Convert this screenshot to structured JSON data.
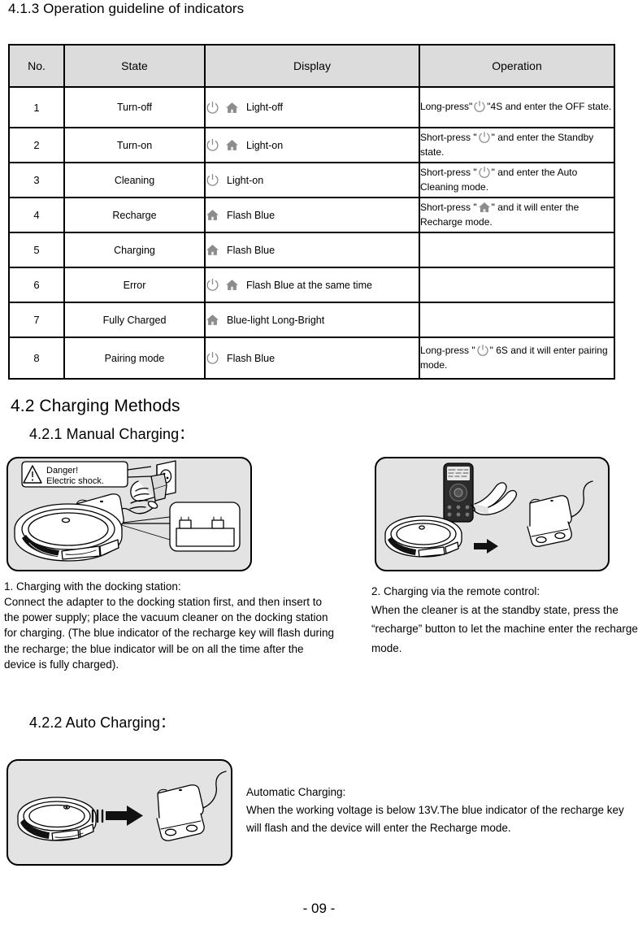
{
  "headings": {
    "s413": "4.1.3 Operation guideline of indicators",
    "s42": "4.2 Charging Methods",
    "s421": "4.2.1 Manual Charging：",
    "s422": "4.2.2 Auto Charging："
  },
  "table": {
    "columns": [
      "No.",
      "State",
      "Display",
      "Operation"
    ],
    "rows": [
      {
        "no": "1",
        "state": "Turn-off",
        "display_icons": [
          "power-icon",
          "home-icon"
        ],
        "display": "Light-off",
        "operation_pre": "Long-press\"",
        "operation_icon": "power-icon",
        "operation_post": "\"4S and enter the OFF state."
      },
      {
        "no": "2",
        "state": "Turn-on",
        "display_icons": [
          "power-icon",
          "home-icon"
        ],
        "display": "Light-on",
        "operation_pre": "Short-press \"",
        "operation_icon": "power-icon",
        "operation_post": "\" and enter the Standby state."
      },
      {
        "no": "3",
        "state": "Cleaning",
        "display_icons": [
          "power-icon"
        ],
        "display": "Light-on",
        "operation_pre": "Short-press \"",
        "operation_icon": "power-icon",
        "operation_post": "\" and enter the Auto Cleaning mode."
      },
      {
        "no": "4",
        "state": "Recharge",
        "display_icons": [
          "home-icon"
        ],
        "display": "Flash Blue",
        "operation_pre": "Short-press \"",
        "operation_icon": "home-icon",
        "operation_post": "\" and it will enter the Recharge mode."
      },
      {
        "no": "5",
        "state": "Charging",
        "display_icons": [
          "home-icon"
        ],
        "display": "Flash Blue",
        "operation_pre": "",
        "operation_icon": "",
        "operation_post": ""
      },
      {
        "no": "6",
        "state": "Error",
        "display_icons": [
          "power-icon",
          "home-icon"
        ],
        "display": "Flash Blue at the same time",
        "operation_pre": "",
        "operation_icon": "",
        "operation_post": ""
      },
      {
        "no": "7",
        "state": "Fully Charged",
        "display_icons": [
          "home-icon"
        ],
        "display": "Blue-light Long-Bright",
        "operation_pre": "",
        "operation_icon": "",
        "operation_post": ""
      },
      {
        "no": "8",
        "state": "Pairing mode",
        "display_icons": [
          "power-icon"
        ],
        "display": "Flash Blue",
        "operation_pre": "Long-press \"",
        "operation_icon": "power-icon",
        "operation_post": "\" 6S and it will enter pairing mode."
      }
    ]
  },
  "illustrations": {
    "manual_dock": {
      "warning_line1": "Danger!",
      "warning_line2": "Electric shock."
    },
    "manual_remote": {},
    "auto_charging": {}
  },
  "paragraphs": {
    "manual_dock": "1. Charging with the docking station:\nConnect the adapter to the docking station first, and then insert to the power supply; place the vacuum cleaner on the docking station for charging. (The blue indicator of the recharge key will flash during the recharge; the blue indicator will be on all the time after the device is fully charged).",
    "manual_remote": "2. Charging via the remote control:\nWhen the cleaner is at the standby state, press the “recharge” button to let the machine enter the recharge mode.",
    "auto_charging": "Automatic Charging:\nWhen the working voltage is below 13V.The blue indicator of the recharge key will flash and the device will enter the Recharge mode."
  },
  "footer": {
    "page_number": "- 09 -"
  },
  "colors": {
    "header_fill": "#dcdcdc",
    "panel_fill": "#e3e3e3",
    "icon_gray": "#8c8c8c",
    "border": "#000000"
  }
}
